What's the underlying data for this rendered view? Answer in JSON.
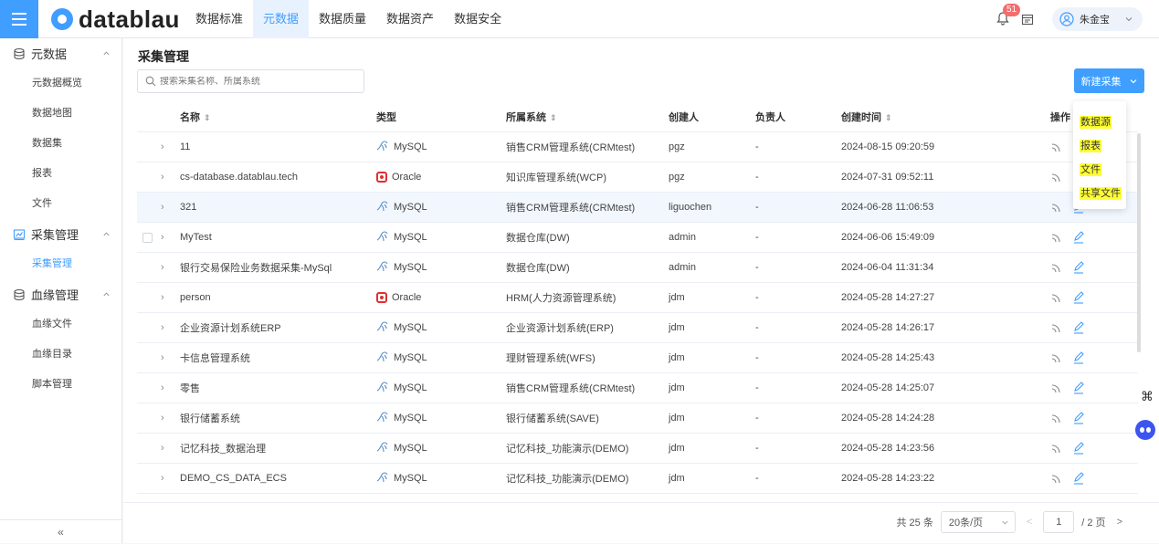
{
  "header": {
    "logo_text": "datablau",
    "nav": [
      "数据标准",
      "元数据",
      "数据质量",
      "数据资产",
      "数据安全"
    ],
    "active_nav": 1,
    "notification_count": "51",
    "user_name": "朱金宝"
  },
  "sidebar": {
    "groups": [
      {
        "label": "元数据",
        "items": [
          "元数据概览",
          "数据地图",
          "数据集",
          "报表",
          "文件"
        ]
      },
      {
        "label": "采集管理",
        "items": [
          "采集管理"
        ]
      },
      {
        "label": "血缘管理",
        "items": [
          "血缘文件",
          "血缘目录",
          "脚本管理"
        ]
      }
    ],
    "collapse_label": "«"
  },
  "main": {
    "title": "采集管理",
    "search_placeholder": "搜索采集名称、所属系统",
    "new_button": "新建采集",
    "dropdown": [
      "数据源",
      "报表",
      "文件",
      "共享文件"
    ]
  },
  "table": {
    "headers": {
      "name": "名称",
      "type": "类型",
      "system": "所属系统",
      "creator": "创建人",
      "owner": "负责人",
      "time": "创建时间",
      "ops": "操作"
    },
    "rows": [
      {
        "name": "11",
        "type": "MySQL",
        "system": "销售CRM管理系统(CRMtest)",
        "creator": "pgz",
        "owner": "-",
        "time": "2024-08-15 09:20:59"
      },
      {
        "name": "cs-database.datablau.tech",
        "type": "Oracle",
        "system": "知识库管理系统(WCP)",
        "creator": "pgz",
        "owner": "-",
        "time": "2024-07-31 09:52:11"
      },
      {
        "name": "321",
        "type": "MySQL",
        "system": "销售CRM管理系统(CRMtest)",
        "creator": "liguochen",
        "owner": "-",
        "time": "2024-06-28 11:06:53"
      },
      {
        "name": "MyTest",
        "type": "MySQL",
        "system": "数据仓库(DW)",
        "creator": "admin",
        "owner": "-",
        "time": "2024-06-06 15:49:09"
      },
      {
        "name": "银行交易保险业务数据采集-MySql",
        "type": "MySQL",
        "system": "数据仓库(DW)",
        "creator": "admin",
        "owner": "-",
        "time": "2024-06-04 11:31:34"
      },
      {
        "name": "person",
        "type": "Oracle",
        "system": "HRM(人力资源管理系统)",
        "creator": "jdm",
        "owner": "-",
        "time": "2024-05-28 14:27:27"
      },
      {
        "name": "企业资源计划系统ERP",
        "type": "MySQL",
        "system": "企业资源计划系统(ERP)",
        "creator": "jdm",
        "owner": "-",
        "time": "2024-05-28 14:26:17"
      },
      {
        "name": "卡信息管理系统",
        "type": "MySQL",
        "system": "理财管理系统(WFS)",
        "creator": "jdm",
        "owner": "-",
        "time": "2024-05-28 14:25:43"
      },
      {
        "name": "零售",
        "type": "MySQL",
        "system": "销售CRM管理系统(CRMtest)",
        "creator": "jdm",
        "owner": "-",
        "time": "2024-05-28 14:25:07"
      },
      {
        "name": "银行储蓄系统",
        "type": "MySQL",
        "system": "银行储蓄系统(SAVE)",
        "creator": "jdm",
        "owner": "-",
        "time": "2024-05-28 14:24:28"
      },
      {
        "name": "记忆科技_数据治理",
        "type": "MySQL",
        "system": "记忆科技_功能演示(DEMO)",
        "creator": "jdm",
        "owner": "-",
        "time": "2024-05-28 14:23:56"
      },
      {
        "name": "DEMO_CS_DATA_ECS",
        "type": "MySQL",
        "system": "记忆科技_功能演示(DEMO)",
        "creator": "jdm",
        "owner": "-",
        "time": "2024-05-28 14:23:22"
      }
    ]
  },
  "pagination": {
    "total": "共 25 条",
    "page_size": "20条/页",
    "current_page": "1",
    "total_pages": "/ 2 页"
  },
  "colors": {
    "accent": "#409eff",
    "oracle": "#e03030",
    "highlight": "#ffff33"
  }
}
